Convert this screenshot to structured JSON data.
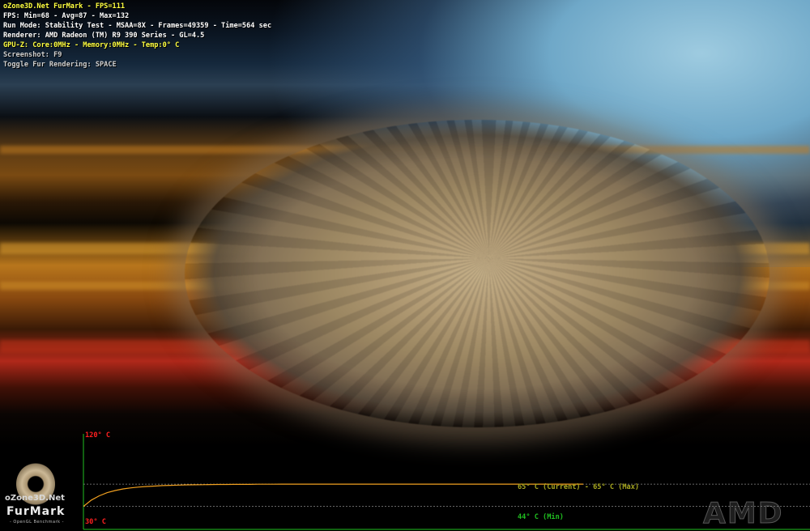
{
  "hud": {
    "title": "oZone3D.Net FurMark - FPS=111",
    "fps_stats": "FPS: Min=68 - Avg=87 - Max=132",
    "run_mode": "Run Mode: Stability Test - MSAA=8X - Frames=49359 - Time=564 sec",
    "renderer": "Renderer: AMD Radeon (TM) R9 390 Series - GL=4.5",
    "gpuz": "GPU-Z: Core:0MHz - Memory:0MHz - Temp:0° C",
    "screenshot": "Screenshot: F9",
    "toggle": "Toggle Fur Rendering: SPACE"
  },
  "colors": {
    "title": "#ffff40",
    "text": "#ffffff",
    "gpuz": "#ffff40",
    "hint": "#d0d0d0",
    "max_label": "#ff2020",
    "current_label": "#a8a820",
    "min_label": "#20c020",
    "curve": "#f0a020",
    "axis": "#20c020"
  },
  "graph": {
    "max_scale_label": "120° C",
    "min_scale_label": "30° C",
    "current_label": "65° C (Current) - 65° C (Max)",
    "min_label": "44° C (Min)",
    "y_range": [
      30,
      120
    ],
    "current_temp": 65,
    "max_temp": 65,
    "min_temp": 44,
    "temperature_series": [
      44,
      50,
      54,
      57,
      59,
      60.5,
      61.5,
      62.3,
      62.8,
      63.2,
      63.6,
      63.9,
      64.1,
      64.3,
      64.4,
      64.5,
      64.6,
      64.7,
      64.7,
      64.8,
      64.8,
      64.8,
      64.9,
      64.9,
      64.9,
      65,
      65,
      65,
      65,
      65,
      65,
      65,
      65,
      65,
      65,
      65,
      65,
      65,
      65,
      65,
      65,
      65,
      65,
      65,
      65,
      65,
      65,
      65,
      65,
      65,
      65,
      65,
      65,
      65,
      65,
      65,
      65,
      65,
      65,
      65,
      65,
      65,
      65,
      65
    ]
  },
  "logo": {
    "site": "oZone3D.Net",
    "name": "FurMark",
    "sub": "- OpenGL Benchmark -",
    "icon": "fur-donut-icon"
  },
  "brand_watermark": "AMD"
}
